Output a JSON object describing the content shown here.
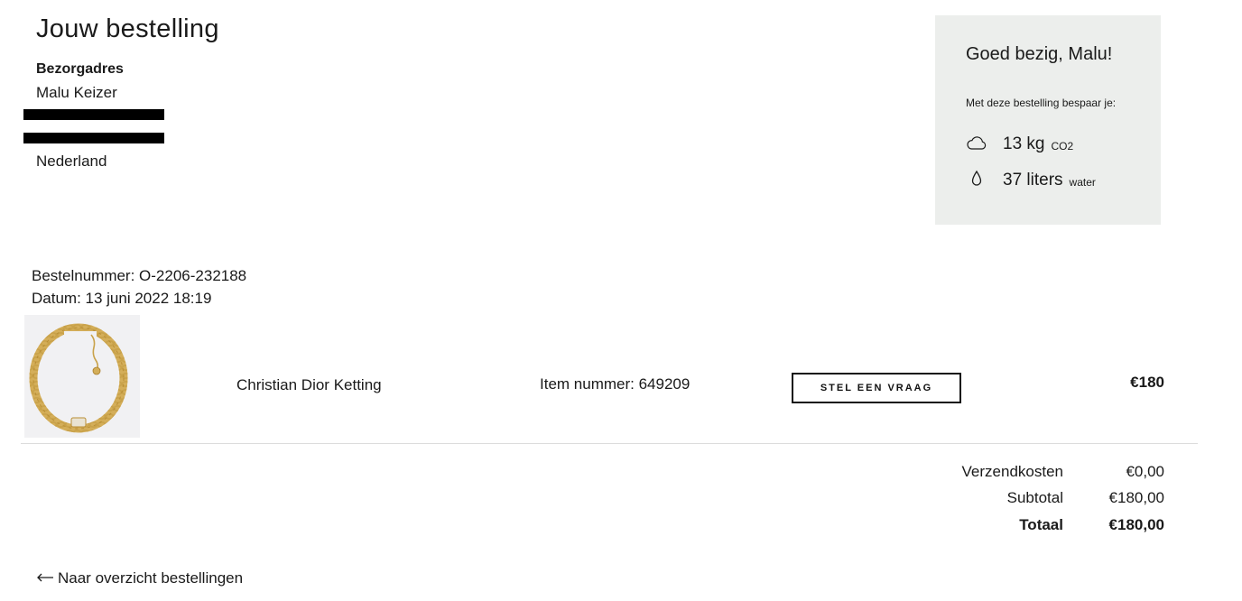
{
  "order": {
    "title": "Jouw bestelling",
    "address": {
      "heading": "Bezorgadres",
      "name": "Malu Keizer",
      "country": "Nederland"
    },
    "savings": {
      "title": "Goed bezig, Malu!",
      "subtitle": "Met deze bestelling bespaar je:",
      "co2": {
        "value": "13 kg",
        "unit": "CO2",
        "icon": "cloud-icon"
      },
      "water": {
        "value": "37 liters",
        "unit": "water",
        "icon": "water-drop-icon"
      }
    },
    "meta": {
      "order_number": "Bestelnummer: O-2206-232188",
      "date": "Datum: 13 juni 2022 18:19"
    },
    "item": {
      "name": "Christian Dior Ketting",
      "item_number": "Item nummer: 649209",
      "ask_button": "STEL EEN VRAAG",
      "price": "€180",
      "image_icon": "gold-chain-necklace"
    },
    "totals": {
      "shipping_label": "Verzendkosten",
      "shipping_value": "€0,00",
      "subtotal_label": "Subtotal",
      "subtotal_value": "€180,00",
      "total_label": "Totaal",
      "total_value": "€180,00"
    },
    "back_link": "Naar overzicht bestellingen",
    "back_icon": "arrow-left-icon"
  }
}
